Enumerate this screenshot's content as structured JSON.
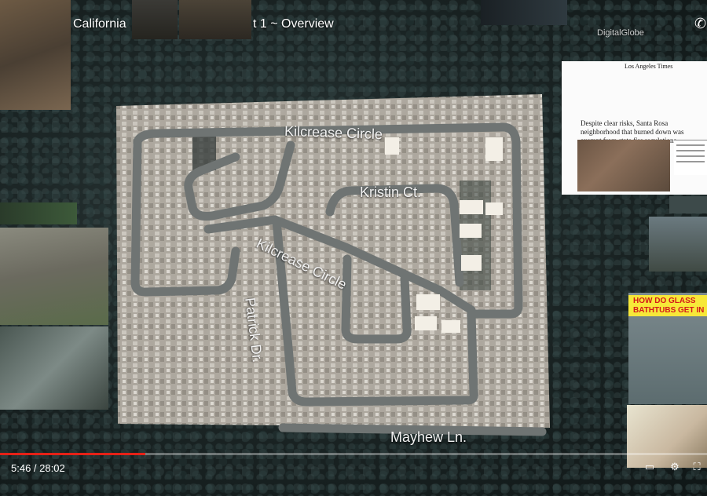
{
  "video": {
    "location_label": "California",
    "chapter_title": "t 1 ~ Overview",
    "watermark": "DigitalGlobe",
    "time_display": "5:46 / 28:02",
    "progress_fraction": 0.206
  },
  "streets": {
    "kilcrease_top": "Kilcrease Circle",
    "kristin": "Kristin Ct.",
    "kilcrease_diag": "Kilcrease Circle",
    "patrick": "Patrick Dr.",
    "mayhew": "Mayhew Ln."
  },
  "news_card": {
    "masthead": "Los Angeles Times",
    "headline": "Despite clear risks, Santa Rosa neighborhood that burned down was exempt from state fire regulations"
  },
  "bathtub_card": {
    "line1": "HOW DO GLASS",
    "line2": "BATHTUBS GET IN"
  },
  "colors": {
    "progress": "#e62117",
    "caption_bg": "#f7e839",
    "caption_text": "#d41a1a"
  }
}
